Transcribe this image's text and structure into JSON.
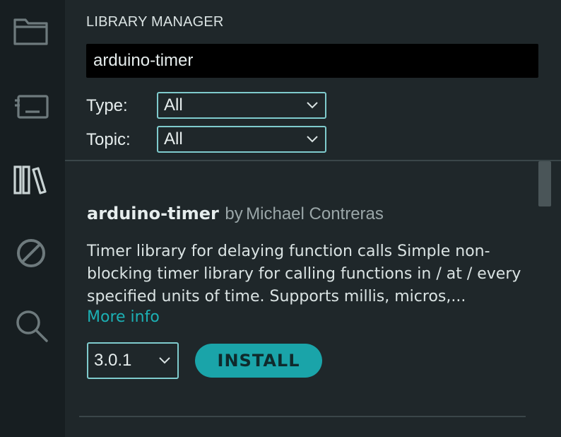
{
  "activity_bar": {
    "icons": [
      "folder-icon",
      "board-icon",
      "library-icon",
      "debug-icon",
      "search-icon"
    ]
  },
  "panel": {
    "title": "LIBRARY MANAGER",
    "search": {
      "value": "arduino-timer",
      "placeholder": ""
    },
    "filters": {
      "type_label": "Type:",
      "type_value": "All",
      "topic_label": "Topic:",
      "topic_value": "All"
    }
  },
  "library": {
    "name": "arduino-timer",
    "by": "by",
    "author": "Michael Contreras",
    "description": "Timer library for delaying function calls Simple non-blocking timer library for calling functions in / at / every specified units of time. Supports millis, micros,...",
    "more_info": "More info",
    "version": "3.0.1",
    "install_label": "INSTALL"
  },
  "colors": {
    "background": "#1f272a",
    "activity_bar": "#171e21",
    "accent": "#1aa4a9",
    "link": "#1cb0b4",
    "select_border": "#7fcbcd"
  }
}
